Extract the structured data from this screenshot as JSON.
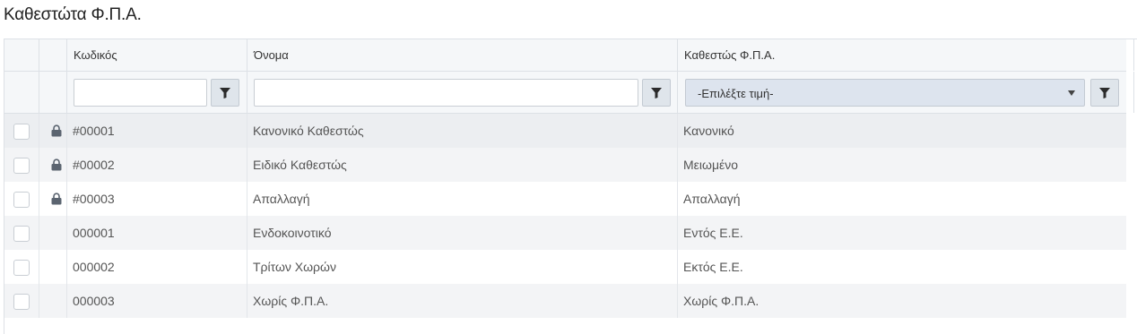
{
  "page": {
    "title": "Καθεστώτα Φ.Π.Α."
  },
  "columns": {
    "code": "Κωδικός",
    "name": "Όνομα",
    "vat": "Καθεστώς Φ.Π.Α."
  },
  "filters": {
    "code_value": "",
    "name_value": "",
    "vat_select": "-Επιλέξτε τιμή-"
  },
  "icons": {
    "filter": "filter-icon",
    "lock": "lock-icon",
    "caret": "chevron-down-icon"
  },
  "rows": [
    {
      "code": "#00001",
      "name": "Κανονικό Καθεστώς",
      "vat": "Κανονικό",
      "locked": true
    },
    {
      "code": "#00002",
      "name": "Ειδικό Καθεστώς",
      "vat": "Μειωμένο",
      "locked": true
    },
    {
      "code": "#00003",
      "name": "Απαλλαγή",
      "vat": "Απαλλαγή",
      "locked": true
    },
    {
      "code": "000001",
      "name": "Ενδοκοινοτικό",
      "vat": "Εντός Ε.Ε.",
      "locked": false
    },
    {
      "code": "000002",
      "name": "Τρίτων Χωρών",
      "vat": "Εκτός Ε.Ε.",
      "locked": false
    },
    {
      "code": "000003",
      "name": "Χωρίς Φ.Π.Α.",
      "vat": "Χωρίς Φ.Π.Α.",
      "locked": false
    }
  ]
}
